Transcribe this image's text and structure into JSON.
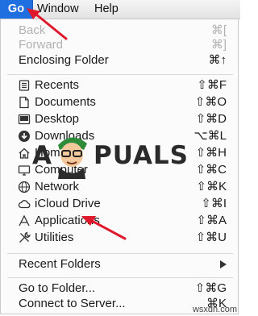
{
  "menubar": {
    "items": [
      {
        "label": "Go",
        "active": true
      },
      {
        "label": "Window"
      },
      {
        "label": "Help"
      }
    ]
  },
  "menu": {
    "group1": [
      {
        "label": "Back",
        "shortcut": "⌘[",
        "disabled": true
      },
      {
        "label": "Forward",
        "shortcut": "⌘]",
        "disabled": true
      },
      {
        "label": "Enclosing Folder",
        "shortcut": "⌘↑"
      }
    ],
    "group2": [
      {
        "label": "Recents",
        "shortcut": "⇧⌘F",
        "icon": "recents-icon"
      },
      {
        "label": "Documents",
        "shortcut": "⇧⌘O",
        "icon": "documents-icon"
      },
      {
        "label": "Desktop",
        "shortcut": "⇧⌘D",
        "icon": "desktop-icon"
      },
      {
        "label": "Downloads",
        "shortcut": "⌥⌘L",
        "icon": "downloads-icon"
      },
      {
        "label": "Home",
        "shortcut": "⇧⌘H",
        "icon": "home-icon"
      },
      {
        "label": "Computer",
        "shortcut": "⇧⌘C",
        "icon": "computer-icon"
      },
      {
        "label": "Network",
        "shortcut": "⇧⌘K",
        "icon": "network-icon"
      },
      {
        "label": "iCloud Drive",
        "shortcut": "⇧⌘I",
        "icon": "cloud-icon"
      },
      {
        "label": "Applications",
        "shortcut": "⇧⌘A",
        "icon": "applications-icon"
      },
      {
        "label": "Utilities",
        "shortcut": "⇧⌘U",
        "icon": "utilities-icon"
      }
    ],
    "group3": [
      {
        "label": "Recent Folders"
      }
    ],
    "group4": [
      {
        "label": "Go to Folder...",
        "shortcut": "⇧⌘G"
      },
      {
        "label": "Connect to Server...",
        "shortcut": "⌘K"
      }
    ]
  },
  "watermark": {
    "left": "A",
    "right": "PUALS"
  },
  "site": "wsxdn.com",
  "colors": {
    "accent": "#1f6fe0",
    "arrow": "#e0182c",
    "disabled": "#b2b2b2"
  }
}
